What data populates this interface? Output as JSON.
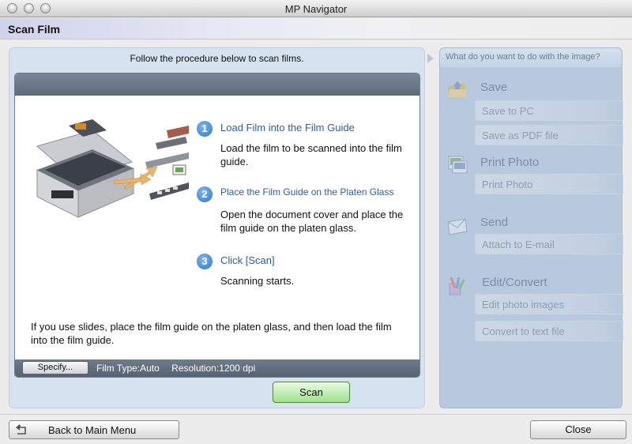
{
  "window": {
    "title": "MP Navigator"
  },
  "header": {
    "title": "Scan Film"
  },
  "main": {
    "instruction": "Follow the procedure below to scan films.",
    "steps": [
      {
        "number": "1",
        "title": "Load Film into the Film Guide",
        "desc": "Load the film to be scanned into the film guide."
      },
      {
        "number": "2",
        "title": "Place the Film Guide on the Platen Glass",
        "desc": "Open the document cover and place the film guide on the platen glass."
      },
      {
        "number": "3",
        "title": "Click [Scan]",
        "desc": "Scanning starts."
      }
    ],
    "note": "If you use slides, place the film guide on the platen glass, and then load the film into the film guide.",
    "specify_label": "Specify...",
    "film_type": "Film Type:Auto",
    "resolution": "Resolution:1200 dpi",
    "scan_label": "Scan"
  },
  "side": {
    "header": "What do you want to do with the image?",
    "sections": [
      {
        "title": "Save",
        "icon": "folder-icon",
        "actions": [
          "Save to PC",
          "Save as PDF file"
        ]
      },
      {
        "title": "Print Photo",
        "icon": "photo-print-icon",
        "actions": [
          "Print Photo"
        ]
      },
      {
        "title": "Send",
        "icon": "envelope-icon",
        "actions": [
          "Attach to E-mail"
        ]
      },
      {
        "title": "Edit/Convert",
        "icon": "edit-tools-icon",
        "actions": [
          "Edit photo images",
          "Convert to text file"
        ]
      }
    ]
  },
  "footer": {
    "back_label": "Back to Main Menu",
    "close_label": "Close"
  },
  "colors": {
    "accent_blue": "#2a5ea8",
    "scan_button_green": "#9fe08e",
    "side_panel": "#b9c9dd"
  }
}
